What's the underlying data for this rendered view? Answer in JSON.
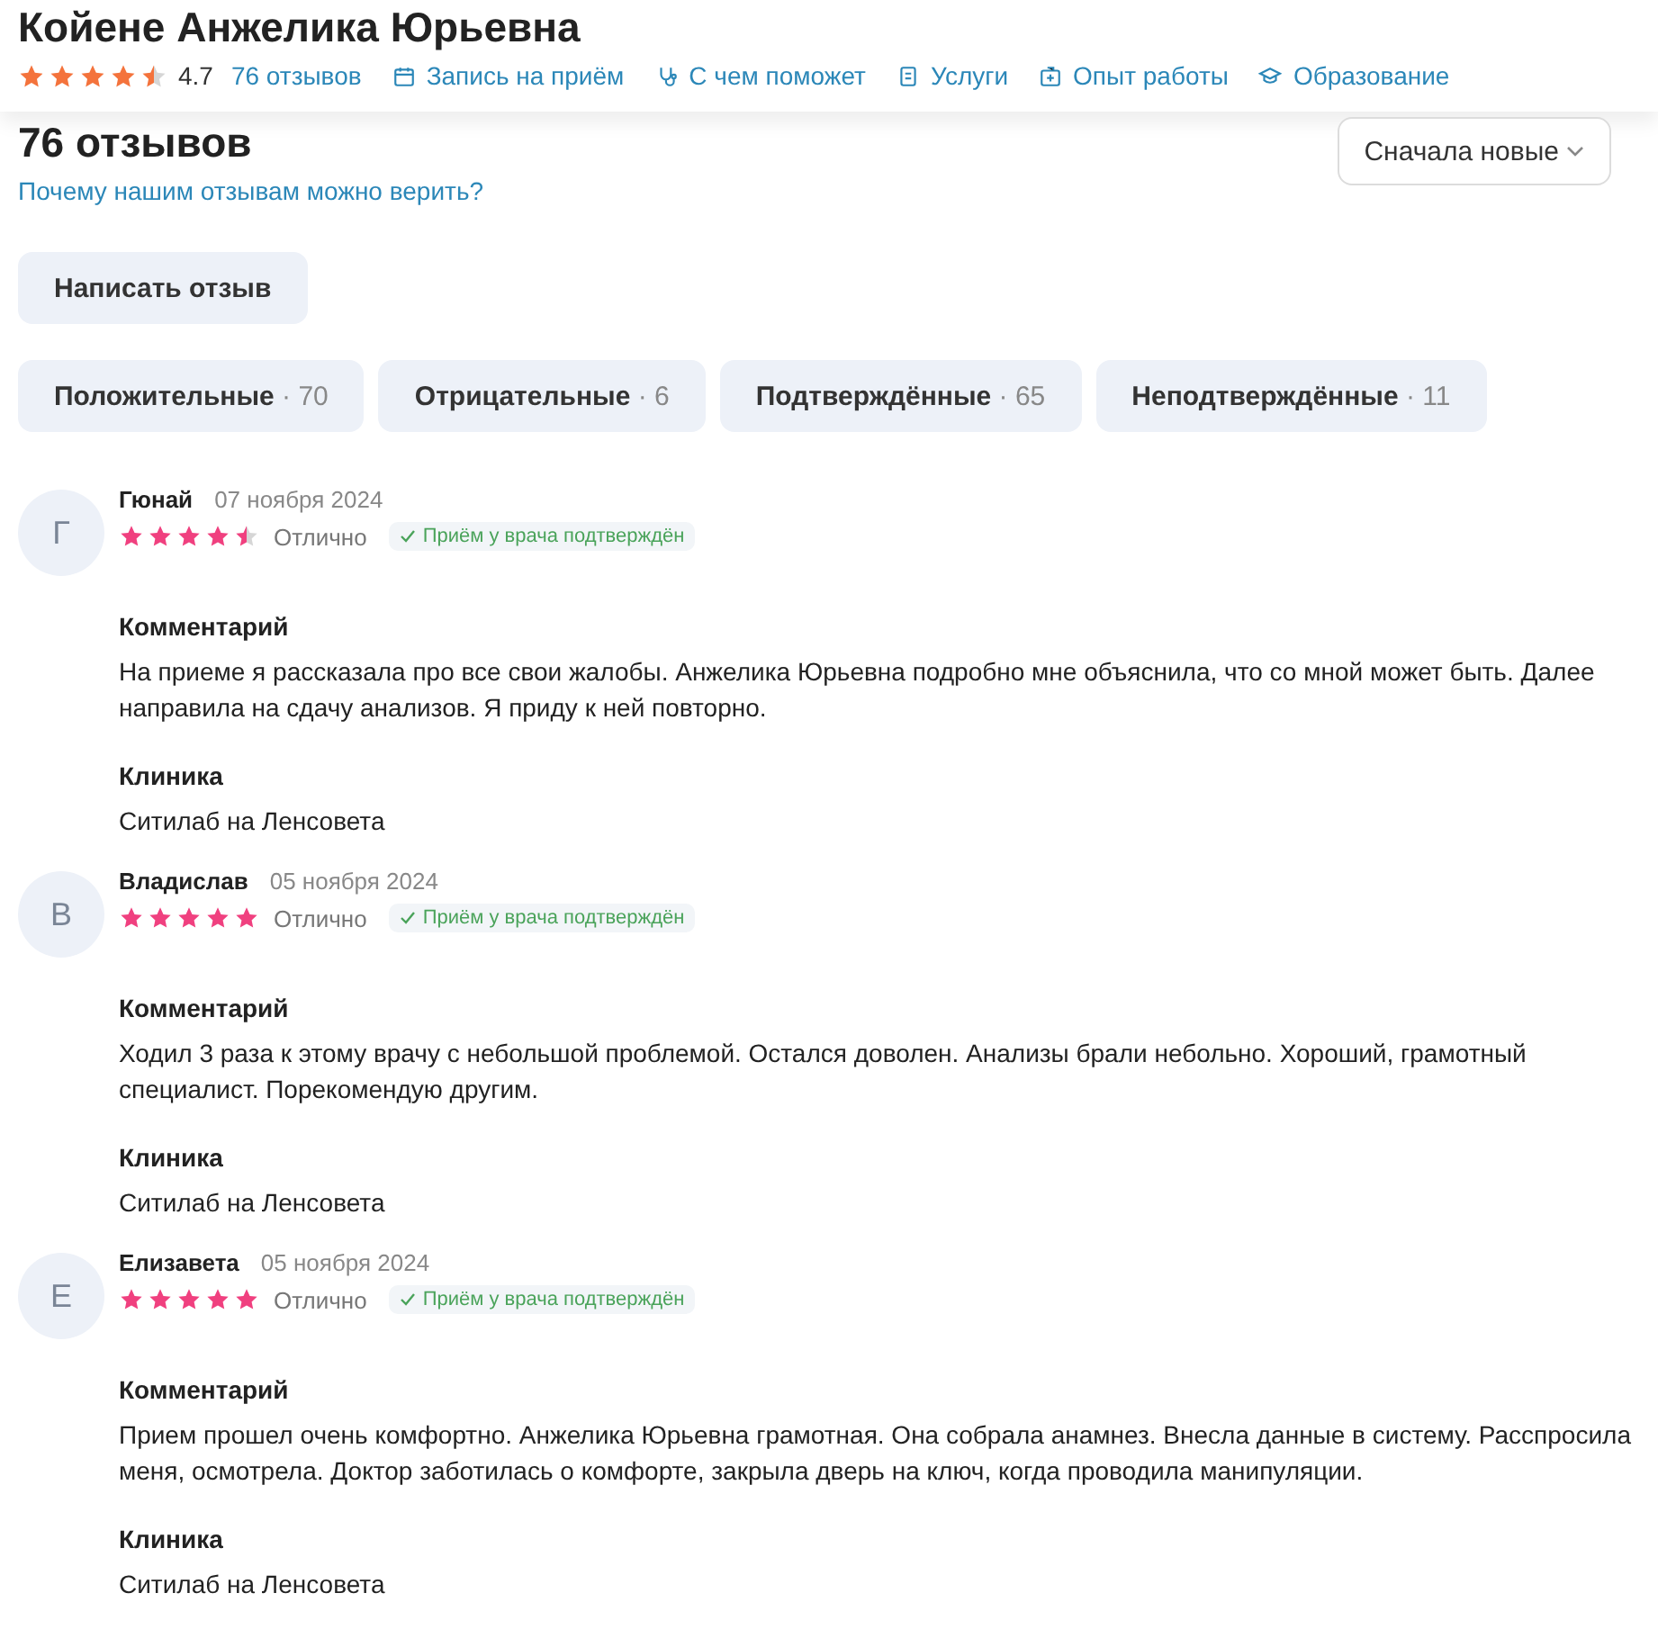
{
  "doctor": {
    "name": "Койене Анжелика Юрьевна",
    "stars": 4.5,
    "rating": "4.7",
    "links": [
      {
        "label": "76 отзывов"
      },
      {
        "label": "Запись на приём"
      },
      {
        "label": "С чем поможет"
      },
      {
        "label": "Услуги"
      },
      {
        "label": "Опыт работы"
      },
      {
        "label": "Образование"
      }
    ]
  },
  "reviews_header": {
    "title": "76 отзывов",
    "trust_link": "Почему нашим отзывам можно верить?",
    "sort": "Сначала новые",
    "write_button": "Написать отзыв"
  },
  "filters": [
    {
      "label": "Положительные",
      "count": "· 70",
      "selected": false
    },
    {
      "label": "Отрицательные",
      "count": "· 6",
      "selected": false
    },
    {
      "label": "Подтверждённые",
      "count": "· 65",
      "selected": false
    },
    {
      "label": "Неподтверждённые",
      "count": "· 11",
      "selected": false
    }
  ],
  "reviews": [
    {
      "initial": "Г",
      "author": "Гюнай",
      "date": "07 ноября 2024",
      "stars": 4.5,
      "grade": "Отлично",
      "badge": "Приём у врача подтверждён",
      "comment_label": "Комментарий",
      "comment": "На приеме я рассказала про все свои жалобы. Анжелика Юрьевна подробно мне объяснила, что со мной может быть. Далее направила на сдачу анализов. Я приду к ней повторно.",
      "clinic_label": "Клиника",
      "clinic": "Ситилаб на Ленсовета"
    },
    {
      "initial": "В",
      "author": "Владислав",
      "date": "05 ноября 2024",
      "stars": 5,
      "grade": "Отлично",
      "badge": "Приём у врача подтверждён",
      "comment_label": "Комментарий",
      "comment": "Ходил 3 раза к этому врачу с небольшой проблемой. Остался доволен. Анализы брали небольно. Хороший, грамотный специалист. Порекомендую другим.",
      "clinic_label": "Клиника",
      "clinic": "Ситилаб на Ленсовета"
    },
    {
      "initial": "Е",
      "author": "Елизавета",
      "date": "05 ноября 2024",
      "stars": 5,
      "grade": "Отлично",
      "badge": "Приём у врача подтверждён",
      "comment_label": "Комментарий",
      "comment": "Прием прошел очень комфортно. Анжелика Юрьевна грамотная. Она собрала анамнез. Внесла данные в систему. Расспросила меня, осмотрела. Доктор заботилась о комфорте, закрыла дверь на ключ, когда проводила манипуляции.",
      "clinic_label": "Клиника",
      "clinic": "Ситилаб на Ленсовета"
    }
  ]
}
